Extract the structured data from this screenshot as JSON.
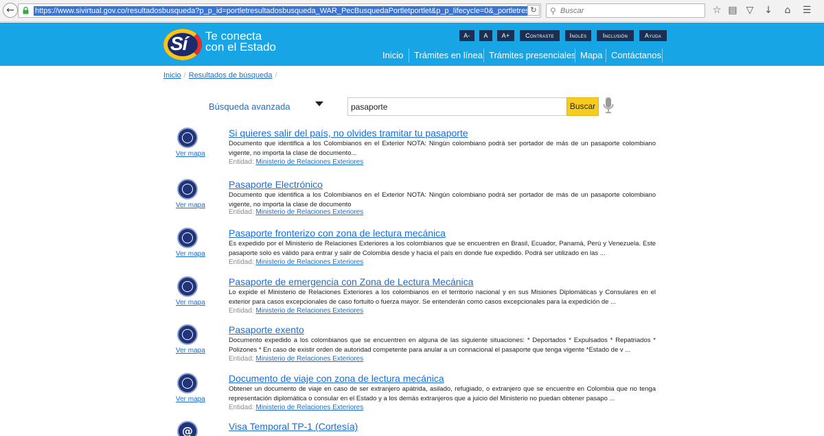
{
  "browser": {
    "url": "https://www.sivirtual.gov.co/resultadosbusqueda?p_p_id=portletresultadosbusqueda_WAR_PecBusquedaPortletportlet&p_p_lifecycle=0&_portletresultadosbusqueda_WAR",
    "search_placeholder": "Buscar",
    "toolbar_icons": [
      "back-icon",
      "lock-icon",
      "reload-icon",
      "search-icon",
      "star-icon",
      "reading-list-icon",
      "pocket-icon",
      "download-icon",
      "home-icon",
      "menu-icon"
    ]
  },
  "header": {
    "logo_mark": "Sí",
    "logo_line1": "Te conecta",
    "logo_line2": "con el Estado",
    "util_buttons": [
      "A-",
      "A",
      "A+",
      "Contraste",
      "Inglés",
      "Inclusión",
      "Ayuda"
    ],
    "nav": [
      "Inicio",
      "Trámites en línea",
      "Trámites presenciales",
      "Mapa",
      "Contáctanos"
    ]
  },
  "breadcrumb": [
    "Inicio",
    "Resultados de búsqueda"
  ],
  "search": {
    "advanced_label": "Búsqueda avanzada",
    "query": "pasaporte",
    "button_label": "Buscar"
  },
  "results": {
    "map_label": "Ver mapa",
    "entity_label": "Entidad:",
    "items": [
      {
        "title": "Si quieres salir del país, no olvides tramitar tu pasaporte",
        "desc": "Documento que identifica a los Colombianos en el Exterior NOTA: Ningún colombiano podrá ser portador de más de un pasaporte colombiano vigente, no importa la clase de documento...",
        "entity": "Ministerio de Relaciones Exteriores"
      },
      {
        "title": "Pasaporte Electrónico",
        "desc": "Documento que identifica a los Colombianos en el Exterior NOTA: Ningún colombiano podrá ser portador de más de un pasaporte colombiano vigente, no importa la clase de documento",
        "entity": "Ministerio de Relaciones Exteriores"
      },
      {
        "title": "Pasaporte fronterizo con zona de lectura mecánica",
        "desc": "Es expedido por el Ministerio de Relaciones Exteriores a los colombianos que se encuentren en Brasil, Ecuador, Panamá, Perú y Venezuela. Este pasaporte solo es válido para entrar y salir de Colombia desde y hacia el país en donde fue expedido. Podrá ser utilizado en las ...",
        "entity": "Ministerio de Relaciones Exteriores"
      },
      {
        "title": "Pasaporte de emergencia con Zona de Lectura Mecánica",
        "desc": "Lo expide el Ministerio de Relaciones Exteriores a los colombianos en el territorio nacional y en sus Misiones Diplomáticas y Consulares en el exterior para casos excepcionales de caso fortuito o fuerza mayor. Se entenderán como casos excepcionales para la expedición de ...",
        "entity": "Ministerio de Relaciones Exteriores"
      },
      {
        "title": "Pasaporte exento",
        "desc": "Documento expedido a los colombianos que se encuentren en alguna de las siguiente situaciones: * Deportados * Expulsados * Repatriados * Polizones * En caso de existir orden de autoridad competente para anular a un connacional el pasaporte que tenga vigente *Estado de v ...",
        "entity": "Ministerio de Relaciones Exteriores"
      },
      {
        "title": "Documento de viaje con zona de lectura mecánica",
        "desc": "Obtener un documento de viaje en caso de ser extranjero apátrida, asilado, refugiado, o extranjero que se encuentre en Colombia que no tenga representación diplomática o consular en el Estado y a los demás extranjeros que a juicio del Ministerio no puedan obtener pasapo ...",
        "entity": "Ministerio de Relaciones Exteriores"
      },
      {
        "title": "Visa Temporal TP-1 (Cortesía)",
        "desc": "",
        "entity": ""
      }
    ]
  },
  "colors": {
    "header_blue": "#17a5e6",
    "util_button_bg": "#1a2f52",
    "link_blue": "#1a6dd6",
    "buscar_yellow": "#f6cd1e"
  }
}
